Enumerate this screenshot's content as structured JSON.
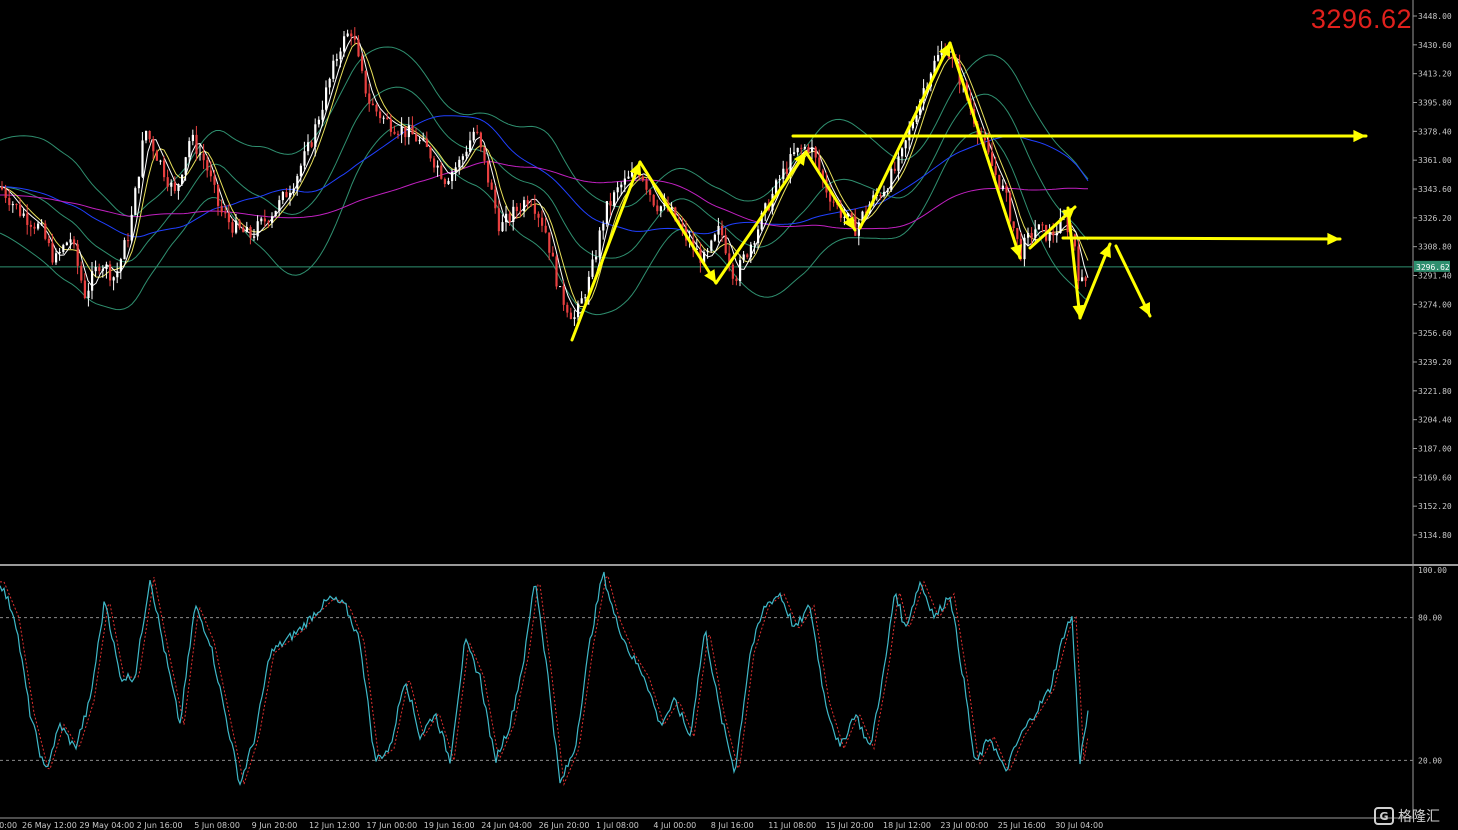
{
  "current_price": "3296.62",
  "price_axis_labels": [
    "3448.00",
    "3430.60",
    "3413.20",
    "3395.80",
    "3378.40",
    "3361.00",
    "3343.60",
    "3326.20",
    "3308.80",
    "3291.40",
    "3274.00",
    "3256.60",
    "3239.20",
    "3221.80",
    "3204.40",
    "3187.00",
    "3169.60",
    "3152.20",
    "3134.80"
  ],
  "oscillator_axis_labels": [
    "100.00",
    "80.00",
    "20.00"
  ],
  "time_axis_labels": [
    "00:00",
    "26 May 12:00",
    "29 May 04:00",
    "2 Jun 16:00",
    "5 Jun 08:00",
    "9 Jun 20:00",
    "12 Jun 12:00",
    "17 Jun 00:00",
    "19 Jun 16:00",
    "24 Jun 04:00",
    "26 Jun 20:00",
    "1 Jul 08:00",
    "4 Jul 00:00",
    "8 Jul 16:00",
    "11 Jul 08:00",
    "15 Jul 20:00",
    "18 Jul 12:00",
    "23 Jul 00:00",
    "25 Jul 16:00",
    "30 Jul 04:00"
  ],
  "watermark": {
    "icon": "G",
    "text": "格隆汇"
  },
  "colors": {
    "background": "#000000",
    "bull_candle": "#ffffff",
    "bear_candle": "#e84040",
    "bollinger": "#2f8f6f",
    "ma_fast": "#e8e05a",
    "ma_mid": "#ffffff",
    "ma_slow": "#2040ff",
    "ma_long": "#c020c0",
    "annotation": "#ffff00",
    "stoch_main": "#3fb8c8",
    "stoch_signal": "#e03030",
    "price_line": "#2f8f6f",
    "axis_text": "#c8c8c8",
    "price_red": "#e0201c"
  },
  "chart_data": {
    "type": "candlestick",
    "price_pane": {
      "ylim": [
        3134.8,
        3448.0
      ],
      "current_price": 3296.62,
      "price_path": [
        [
          0,
          3345
        ],
        [
          20,
          3330
        ],
        [
          40,
          3320
        ],
        [
          55,
          3300
        ],
        [
          70,
          3315
        ],
        [
          85,
          3280
        ],
        [
          100,
          3300
        ],
        [
          115,
          3290
        ],
        [
          130,
          3320
        ],
        [
          145,
          3380
        ],
        [
          160,
          3360
        ],
        [
          175,
          3340
        ],
        [
          190,
          3375
        ],
        [
          205,
          3360
        ],
        [
          220,
          3330
        ],
        [
          235,
          3320
        ],
        [
          250,
          3315
        ],
        [
          265,
          3325
        ],
        [
          280,
          3335
        ],
        [
          295,
          3350
        ],
        [
          310,
          3370
        ],
        [
          325,
          3400
        ],
        [
          340,
          3430
        ],
        [
          352,
          3440
        ],
        [
          360,
          3415
        ],
        [
          370,
          3395
        ],
        [
          385,
          3385
        ],
        [
          400,
          3380
        ],
        [
          415,
          3375
        ],
        [
          430,
          3365
        ],
        [
          445,
          3350
        ],
        [
          460,
          3360
        ],
        [
          475,
          3380
        ],
        [
          490,
          3345
        ],
        [
          500,
          3320
        ],
        [
          515,
          3330
        ],
        [
          530,
          3340
        ],
        [
          545,
          3320
        ],
        [
          560,
          3280
        ],
        [
          575,
          3265
        ],
        [
          590,
          3290
        ],
        [
          605,
          3330
        ],
        [
          620,
          3345
        ],
        [
          640,
          3355
        ],
        [
          655,
          3335
        ],
        [
          670,
          3330
        ],
        [
          690,
          3310
        ],
        [
          705,
          3300
        ],
        [
          720,
          3320
        ],
        [
          735,
          3290
        ],
        [
          750,
          3310
        ],
        [
          765,
          3330
        ],
        [
          780,
          3350
        ],
        [
          795,
          3365
        ],
        [
          810,
          3370
        ],
        [
          825,
          3345
        ],
        [
          840,
          3330
        ],
        [
          855,
          3320
        ],
        [
          870,
          3335
        ],
        [
          885,
          3345
        ],
        [
          900,
          3360
        ],
        [
          915,
          3390
        ],
        [
          930,
          3415
        ],
        [
          945,
          3430
        ],
        [
          960,
          3410
        ],
        [
          975,
          3385
        ],
        [
          990,
          3360
        ],
        [
          1005,
          3340
        ],
        [
          1020,
          3305
        ],
        [
          1035,
          3320
        ],
        [
          1050,
          3315
        ],
        [
          1065,
          3325
        ],
        [
          1075,
          3310
        ],
        [
          1080,
          3285
        ],
        [
          1088,
          3290
        ]
      ],
      "annotation_arrows": [
        {
          "points": [
            [
              3248,
              "zigzag"
            ]
          ],
          "label": ""
        }
      ]
    },
    "oscillator_pane": {
      "ylim": [
        0,
        100
      ],
      "levels": [
        20,
        80
      ],
      "values": [
        [
          0,
          95
        ],
        [
          15,
          80
        ],
        [
          30,
          40
        ],
        [
          45,
          15
        ],
        [
          60,
          35
        ],
        [
          75,
          25
        ],
        [
          90,
          45
        ],
        [
          105,
          88
        ],
        [
          120,
          55
        ],
        [
          135,
          55
        ],
        [
          150,
          97
        ],
        [
          165,
          65
        ],
        [
          180,
          35
        ],
        [
          195,
          85
        ],
        [
          210,
          70
        ],
        [
          225,
          40
        ],
        [
          240,
          10
        ],
        [
          255,
          30
        ],
        [
          270,
          65
        ],
        [
          285,
          70
        ],
        [
          300,
          75
        ],
        [
          315,
          82
        ],
        [
          330,
          88
        ],
        [
          345,
          85
        ],
        [
          360,
          70
        ],
        [
          375,
          20
        ],
        [
          390,
          25
        ],
        [
          405,
          55
        ],
        [
          420,
          30
        ],
        [
          435,
          40
        ],
        [
          450,
          20
        ],
        [
          465,
          70
        ],
        [
          480,
          55
        ],
        [
          495,
          20
        ],
        [
          510,
          35
        ],
        [
          525,
          65
        ],
        [
          535,
          97
        ],
        [
          548,
          55
        ],
        [
          560,
          10
        ],
        [
          575,
          25
        ],
        [
          590,
          70
        ],
        [
          603,
          99
        ],
        [
          615,
          80
        ],
        [
          630,
          65
        ],
        [
          645,
          55
        ],
        [
          660,
          35
        ],
        [
          675,
          45
        ],
        [
          690,
          30
        ],
        [
          705,
          75
        ],
        [
          720,
          40
        ],
        [
          735,
          15
        ],
        [
          750,
          65
        ],
        [
          765,
          85
        ],
        [
          780,
          90
        ],
        [
          795,
          75
        ],
        [
          810,
          85
        ],
        [
          825,
          45
        ],
        [
          840,
          25
        ],
        [
          855,
          40
        ],
        [
          870,
          25
        ],
        [
          885,
          60
        ],
        [
          895,
          92
        ],
        [
          905,
          75
        ],
        [
          920,
          95
        ],
        [
          935,
          80
        ],
        [
          950,
          90
        ],
        [
          965,
          50
        ],
        [
          975,
          18
        ],
        [
          990,
          30
        ],
        [
          1005,
          15
        ],
        [
          1020,
          30
        ],
        [
          1035,
          40
        ],
        [
          1050,
          50
        ],
        [
          1065,
          75
        ],
        [
          1072,
          80
        ],
        [
          1080,
          20
        ],
        [
          1088,
          40
        ]
      ]
    }
  }
}
